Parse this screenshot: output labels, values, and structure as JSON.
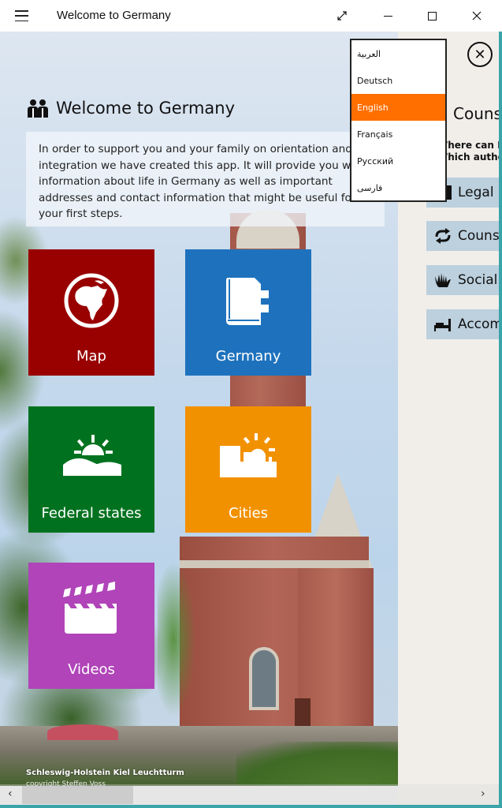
{
  "window": {
    "title": "Welcome to Germany",
    "controls": {
      "fullscreen_icon": "expand-diagonal-icon",
      "minimize_icon": "minimize-icon",
      "maximize_icon": "maximize-icon",
      "close_icon": "close-icon",
      "close_glyph": "✕"
    }
  },
  "header": {
    "icon": "people-icon",
    "title": "Welcome to Germany",
    "intro": "In order to support you and your family on orientation and\nintegration we have created this app. It will provide you with\ninformation about life in Germany as well as important\naddresses and contact information that might be useful for\nyour first steps."
  },
  "tiles": [
    {
      "label": "Map",
      "icon": "globe-africa-icon",
      "color": "#990000"
    },
    {
      "label": "Germany",
      "icon": "notebook-icon",
      "color": "#1e72bd"
    },
    {
      "label": "Federal states",
      "icon": "sunrise-hills-icon",
      "color": "#00721f"
    },
    {
      "label": "Cities",
      "icon": "city-sun-icon",
      "color": "#f29100"
    },
    {
      "label": "Videos",
      "icon": "clapperboard-icon",
      "color": "#b044b8"
    }
  ],
  "photo_caption": {
    "title": "Schleswig-Holstein Kiel Leuchtturm",
    "credit": "copyright Steffen Voss"
  },
  "language_menu": {
    "items": [
      "العربية",
      "Deutsch",
      "English",
      "Français",
      "Русский",
      "فارسی"
    ],
    "selected": "English",
    "highlight_color": "#ff6f00"
  },
  "right_panel": {
    "close_glyph": "✕",
    "title": "Counseling",
    "subtitle": "Where can I get help?\nWhich authorities",
    "buttons": [
      {
        "label": "Legal advice",
        "icon": "paragraph-icon"
      },
      {
        "label": "Counseling",
        "icon": "refresh-arrows-icon"
      },
      {
        "label": "Social services",
        "icon": "hands-icon"
      },
      {
        "label": "Accommodation",
        "icon": "bed-icon"
      }
    ],
    "button_color": "#bcd0de"
  },
  "scrollbar": {
    "left_arrow": "‹",
    "right_arrow": "›"
  },
  "accent_color": "#3aa4a9"
}
